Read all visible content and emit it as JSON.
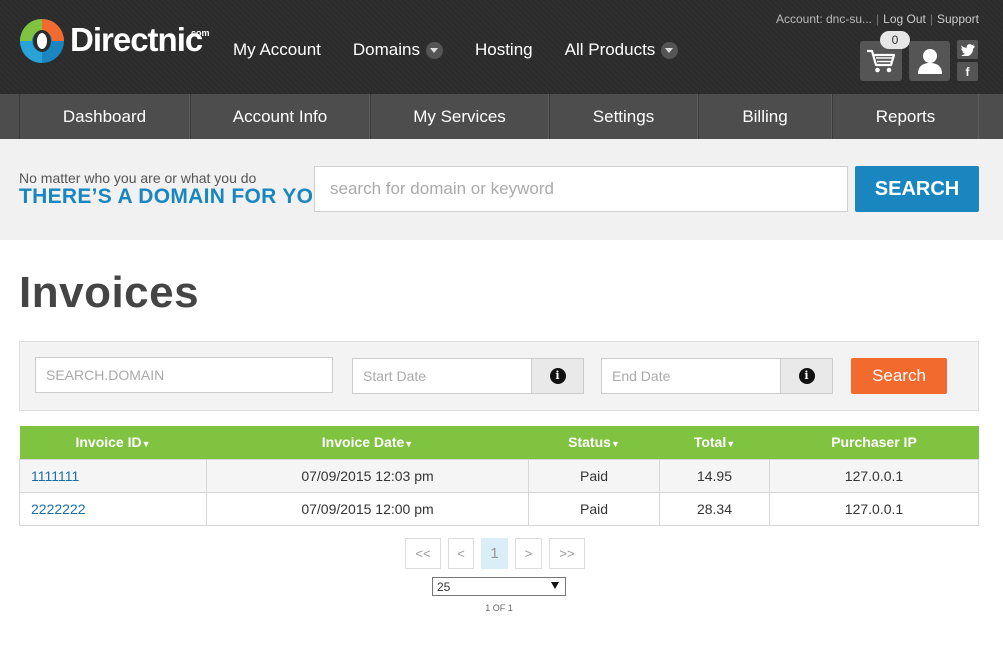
{
  "header": {
    "logo_text": "Directnic",
    "logo_suffix": "com",
    "nav": [
      {
        "label": "My Account",
        "dropdown": false
      },
      {
        "label": "Domains",
        "dropdown": true
      },
      {
        "label": "Hosting",
        "dropdown": false
      },
      {
        "label": "All Products",
        "dropdown": true
      }
    ],
    "account_label": "Account: dnc-su...",
    "logout_label": "Log Out",
    "support_label": "Support",
    "cart_count": "0",
    "twitter_icon": "t",
    "facebook_icon": "f"
  },
  "subnav": [
    {
      "label": "Dashboard"
    },
    {
      "label": "Account Info"
    },
    {
      "label": "My Services"
    },
    {
      "label": "Settings"
    },
    {
      "label": "Billing"
    },
    {
      "label": "Reports"
    }
  ],
  "domain_band": {
    "tagline_small": "No matter who you are or what you do",
    "tagline_big": "THERE’S A DOMAIN FOR YOU:",
    "search_placeholder": "search for domain or keyword",
    "search_button": "SEARCH"
  },
  "page_title": "Invoices",
  "filters": {
    "domain_placeholder": "SEARCH.DOMAIN",
    "start_placeholder": "Start Date",
    "end_placeholder": "End Date",
    "info_glyph": "i",
    "search_button": "Search"
  },
  "table": {
    "columns": [
      {
        "label": "Invoice ID",
        "sortable": true
      },
      {
        "label": "Invoice Date",
        "sortable": true
      },
      {
        "label": "Status",
        "sortable": true
      },
      {
        "label": "Total",
        "sortable": true
      },
      {
        "label": "Purchaser IP",
        "sortable": false
      }
    ],
    "rows": [
      {
        "id": "1111111",
        "date": "07/09/2015 12:03 pm",
        "status": "Paid",
        "total": "14.95",
        "ip": "127.0.0.1"
      },
      {
        "id": "2222222",
        "date": "07/09/2015 12:00 pm",
        "status": "Paid",
        "total": "28.34",
        "ip": "127.0.0.1"
      }
    ]
  },
  "pagination": {
    "first": "<<",
    "prev": "<",
    "current": "1",
    "next": ">",
    "last": ">>",
    "page_size": "25",
    "page_count": "1 OF 1"
  },
  "colors": {
    "accent_blue": "#1a86bf",
    "table_header_green": "#80c341",
    "search_orange": "#f26a2e"
  }
}
